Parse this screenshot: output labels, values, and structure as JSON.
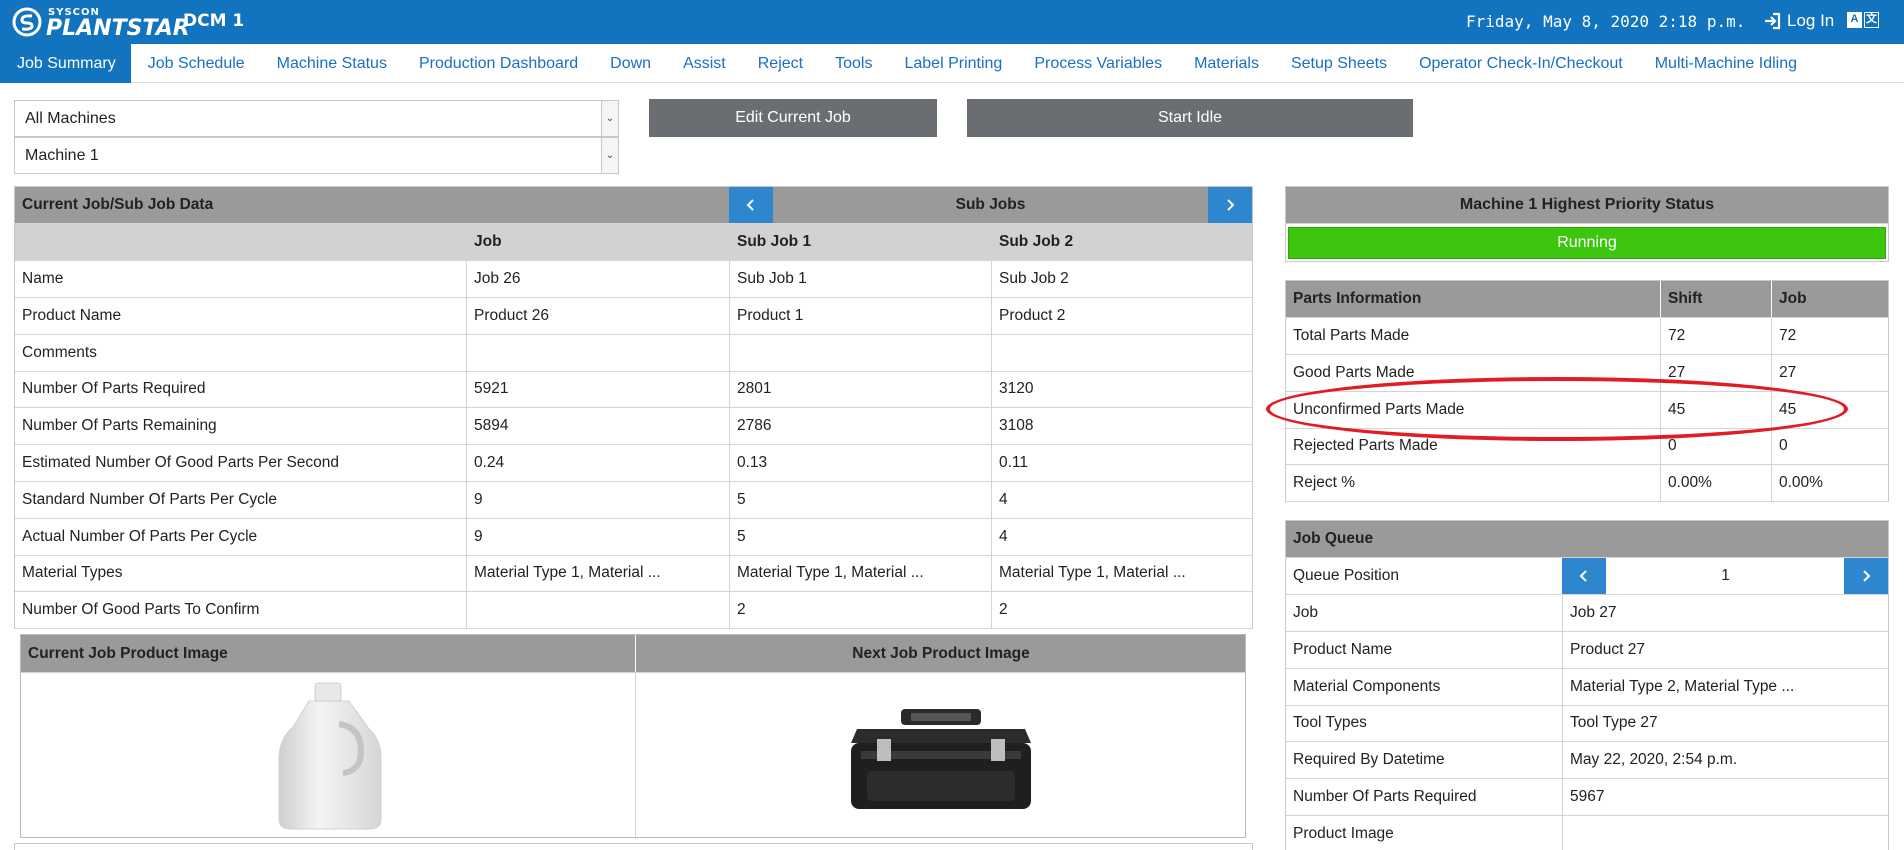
{
  "header": {
    "brand_small": "SYSCON",
    "brand_big": "PLANTSTAR",
    "site": "DCM 1",
    "datetime": "Friday, May 8, 2020 2:18 p.m.",
    "login": "Log In",
    "lang_left": "A",
    "lang_right": "文"
  },
  "nav": {
    "tabs": [
      "Job Summary",
      "Job Schedule",
      "Machine Status",
      "Production Dashboard",
      "Down",
      "Assist",
      "Reject",
      "Tools",
      "Label Printing",
      "Process Variables",
      "Materials",
      "Setup Sheets",
      "Operator Check-In/Checkout",
      "Multi-Machine Idling"
    ]
  },
  "filters": {
    "group": "All Machines",
    "machine": "Machine 1"
  },
  "actions": {
    "edit_job": "Edit Current Job",
    "start_idle": "Start Idle"
  },
  "job_data": {
    "title": "Current Job/Sub Job Data",
    "sub_jobs_label": "Sub Jobs",
    "columns": [
      "Job",
      "Sub Job 1",
      "Sub Job 2"
    ],
    "rows": [
      {
        "label": "Name",
        "values": [
          "Job 26",
          "Sub Job 1",
          "Sub Job 2"
        ]
      },
      {
        "label": "Product Name",
        "values": [
          "Product 26",
          "Product 1",
          "Product 2"
        ]
      },
      {
        "label": "Comments",
        "values": [
          "",
          "",
          ""
        ]
      },
      {
        "label": "Number Of Parts Required",
        "values": [
          "5921",
          "2801",
          "3120"
        ]
      },
      {
        "label": "Number Of Parts Remaining",
        "values": [
          "5894",
          "2786",
          "3108"
        ]
      },
      {
        "label": "Estimated Number Of Good Parts Per Second",
        "values": [
          "0.24",
          "0.13",
          "0.11"
        ]
      },
      {
        "label": "Standard Number Of Parts Per Cycle",
        "values": [
          "9",
          "5",
          "4"
        ]
      },
      {
        "label": "Actual Number Of Parts Per Cycle",
        "values": [
          "9",
          "5",
          "4"
        ]
      },
      {
        "label": "Material Types",
        "values": [
          "Material Type 1, Material ...",
          "Material Type 1, Material ...",
          "Material Type 1, Material ..."
        ]
      },
      {
        "label": "Number Of Good Parts To Confirm",
        "values": [
          "",
          "2",
          "2"
        ]
      }
    ]
  },
  "images": {
    "current_label": "Current Job Product Image",
    "next_label": "Next Job Product Image"
  },
  "status": {
    "title": "Machine 1 Highest Priority Status",
    "value": "Running",
    "color": "#3cc70e"
  },
  "parts": {
    "title": "Parts Information",
    "col_shift": "Shift",
    "col_job": "Job",
    "rows": [
      {
        "label": "Total Parts Made",
        "shift": "72",
        "job": "72"
      },
      {
        "label": "Good Parts Made",
        "shift": "27",
        "job": "27"
      },
      {
        "label": "Unconfirmed Parts Made",
        "shift": "45",
        "job": "45"
      },
      {
        "label": "Rejected Parts Made",
        "shift": "0",
        "job": "0"
      },
      {
        "label": "Reject %",
        "shift": "0.00%",
        "job": "0.00%"
      }
    ]
  },
  "queue": {
    "title": "Job Queue",
    "position_label": "Queue Position",
    "position": "1",
    "rows": [
      {
        "label": "Job",
        "value": "Job 27"
      },
      {
        "label": "Product Name",
        "value": "Product 27"
      },
      {
        "label": "Material Components",
        "value": "Material Type 2, Material Type ..."
      },
      {
        "label": "Tool Types",
        "value": "Tool Type 27"
      },
      {
        "label": "Required By Datetime",
        "value": "May 22, 2020, 2:54 p.m."
      },
      {
        "label": "Number Of Parts Required",
        "value": "5967"
      },
      {
        "label": "Product Image",
        "value": ""
      }
    ]
  }
}
